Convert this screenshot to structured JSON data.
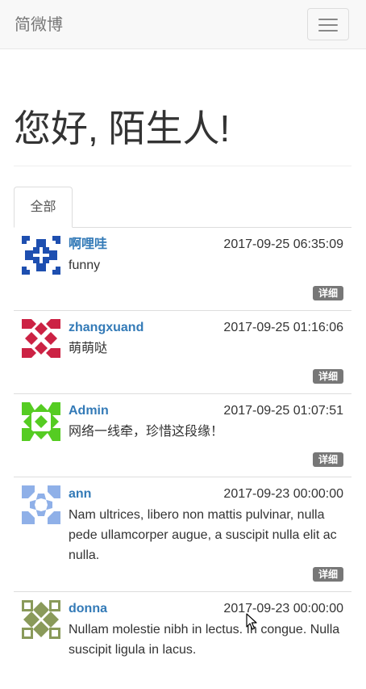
{
  "navbar": {
    "brand": "简微博",
    "menu_icon": "hamburger-menu-icon"
  },
  "greeting": "您好, 陌生人!",
  "tabs": [
    {
      "label": "全部",
      "active": true
    }
  ],
  "detail_label": "详细",
  "posts": [
    {
      "author": "啊哩哇",
      "time": "2017-09-25 06:35:09",
      "content": "funny",
      "avatar_color": "#1e4fb0"
    },
    {
      "author": "zhangxuand",
      "time": "2017-09-25 01:16:06",
      "content": "萌萌哒",
      "avatar_color": "#cc2244"
    },
    {
      "author": "Admin",
      "time": "2017-09-25 01:07:51",
      "content": "网络一线牵，珍惜这段缘！",
      "avatar_color": "#55cc22"
    },
    {
      "author": "ann",
      "time": "2017-09-23 00:00:00",
      "content": "Nam ultrices, libero non mattis pulvinar, nulla pede ullamcorper augue, a suscipit nulla elit ac nulla.",
      "avatar_color": "#8fb0e8"
    },
    {
      "author": "donna",
      "time": "2017-09-23 00:00:00",
      "content": "Nullam molestie nibh in lectus. In congue. Nulla suscipit ligula in lacus.",
      "avatar_color": "#8a9a5a"
    }
  ],
  "colors": {
    "link": "#337ab7",
    "badge": "#777777",
    "navbar_bg": "#f8f8f8"
  }
}
